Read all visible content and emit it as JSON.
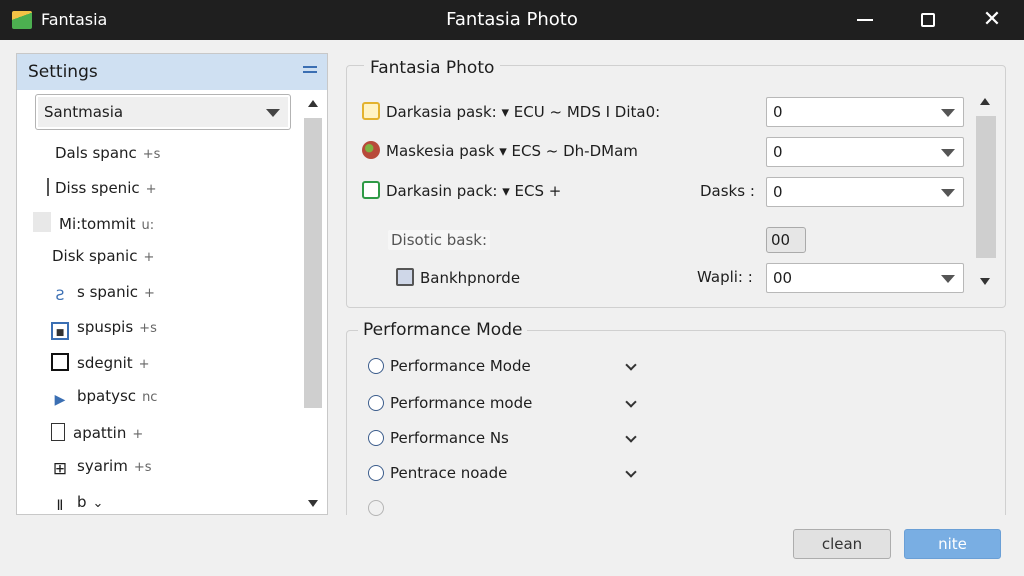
{
  "window": {
    "app_name": "Fantasia",
    "title": "Fantasia Photo",
    "minimize_icon": "minimize-icon",
    "maximize_icon": "maximize-icon",
    "close_icon": "close-icon",
    "close_glyph": "✕"
  },
  "sidebar": {
    "title": "Settings",
    "menu_icon": "hamburger-menu-icon",
    "dropdown_value": "Santmasia",
    "items": [
      {
        "label": "Dals spanc",
        "suffix": "+s",
        "icon": ""
      },
      {
        "label": "Diss spenic",
        "suffix": "+",
        "icon": "bar-icon"
      },
      {
        "label": "Mi:tommit",
        "suffix": "u:",
        "icon": "box-icon"
      },
      {
        "label": "Disk spanic",
        "suffix": "+",
        "icon": ""
      },
      {
        "label": "s spanic",
        "suffix": "+",
        "icon": "sigma-icon",
        "glyph": "Ƨ"
      },
      {
        "label": "spuspis",
        "suffix": "+s",
        "icon": "square-dot-icon",
        "glyph": "■"
      },
      {
        "label": "sdegnit",
        "suffix": "+",
        "icon": "square-icon",
        "glyph": "□"
      },
      {
        "label": "bpatysc",
        "suffix": "nc",
        "icon": "play-icon",
        "glyph": "▶"
      },
      {
        "label": "apattin",
        "suffix": "+",
        "icon": "document-icon",
        "glyph": "▯"
      },
      {
        "label": "syarim",
        "suffix": "+s",
        "icon": "plus-box-icon",
        "glyph": "⊞"
      },
      {
        "label": "b",
        "suffix": "⌄",
        "icon": "bar-icon",
        "glyph": "Ⅱ"
      }
    ]
  },
  "settings_group": {
    "title": "Fantasia Photo",
    "rows": [
      {
        "label": "Darkasia pask: ▾ ECU ~ MDS I Dita0:",
        "icon": "yellow-box-icon",
        "value": "0"
      },
      {
        "label": "Maskesia pask ▾ ECS ~ Dh-DMam",
        "icon": "red-circle-icon",
        "value": "0"
      },
      {
        "label": "Darkasin pack: ▾ ECS +",
        "icon": "green-box-icon",
        "side": "Dasks :",
        "value": "0"
      },
      {
        "label": "Disotic bask:",
        "value": "00"
      },
      {
        "label": "Bankhpnorde",
        "icon": "box-icon",
        "side": "Wapli: :",
        "value": "00"
      }
    ]
  },
  "performance_group": {
    "title": "Performance Mode",
    "options": [
      {
        "label": "Performance Mode"
      },
      {
        "label": "Performance mode"
      },
      {
        "label": "Performance Ns"
      },
      {
        "label": "Pentrace noade"
      }
    ]
  },
  "footer": {
    "clean_label": "clean",
    "ok_label": "nite"
  }
}
